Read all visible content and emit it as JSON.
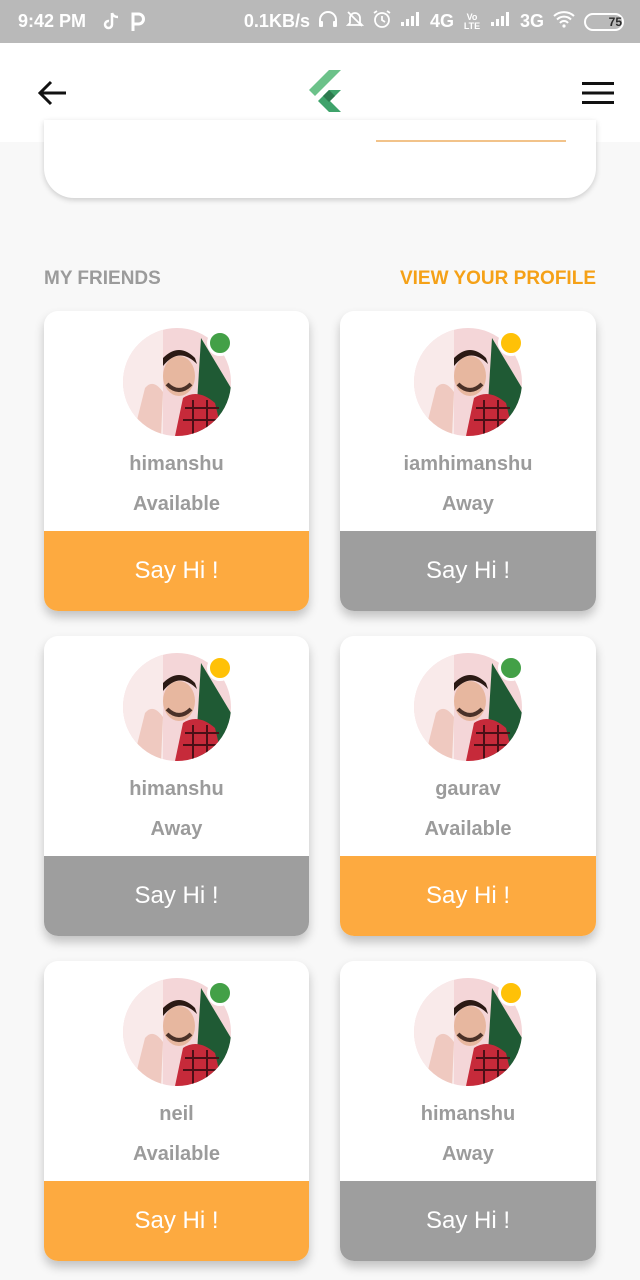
{
  "status_bar": {
    "time": "9:42 PM",
    "speed": "0.1KB/s",
    "net1": "4G",
    "volte": "Vo LTE",
    "net2": "3G",
    "battery": "75"
  },
  "app_bar": {
    "back_icon": "arrow-left-icon",
    "logo_icon": "flutter-logo-icon",
    "menu_icon": "hamburger-menu-icon"
  },
  "section": {
    "title": "MY FRIENDS",
    "action": "VIEW YOUR PROFILE"
  },
  "colors": {
    "accent": "#f5a117",
    "available_button": "#fdaa40",
    "away_button": "#9e9e9e",
    "available_dot": "#43a047",
    "away_dot": "#ffc107"
  },
  "friends": [
    {
      "name": "himanshu",
      "status": "Available",
      "button": "Say Hi !"
    },
    {
      "name": "iamhimanshu",
      "status": "Away",
      "button": "Say Hi !"
    },
    {
      "name": "himanshu",
      "status": "Away",
      "button": "Say Hi !"
    },
    {
      "name": "gaurav",
      "status": "Available",
      "button": "Say Hi !"
    },
    {
      "name": "neil",
      "status": "Available",
      "button": "Say Hi !"
    },
    {
      "name": "himanshu",
      "status": "Away",
      "button": "Say Hi !"
    }
  ]
}
